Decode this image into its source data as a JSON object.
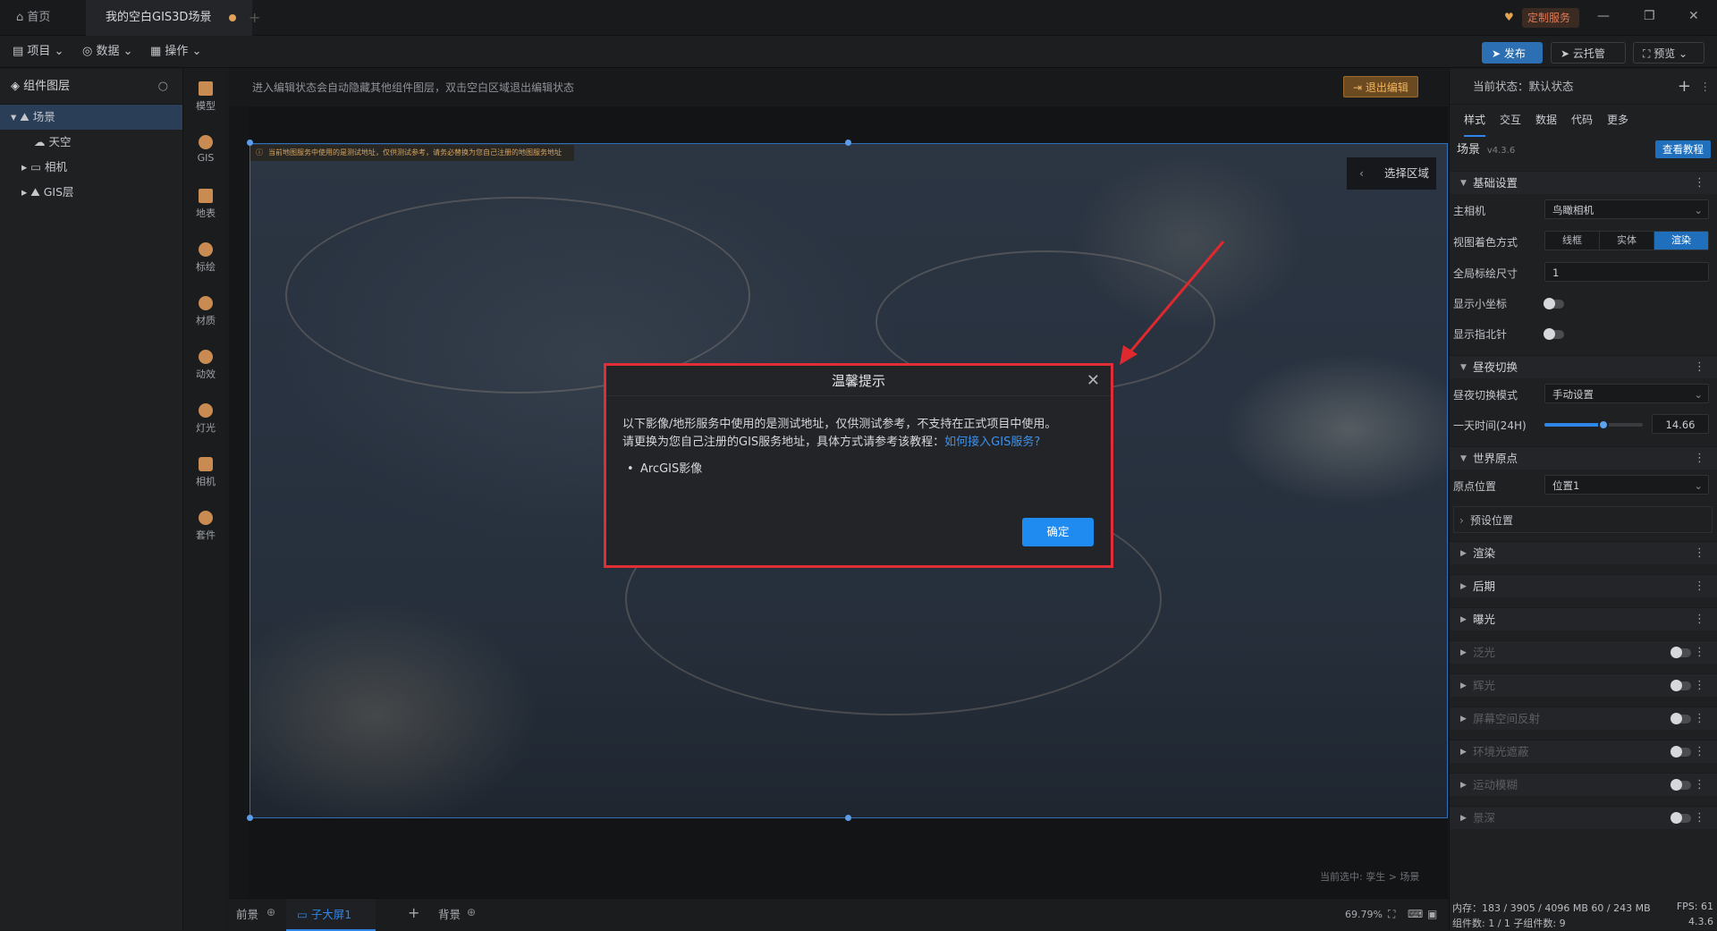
{
  "topbar": {
    "home": "首页",
    "project_tab": "我的空白GIS3D场景",
    "brand_badge": "定制服务"
  },
  "menubar": {
    "project": "项目",
    "data": "数据",
    "operate": "操作",
    "publish": "发布",
    "cloud": "云托管",
    "preview": "预览"
  },
  "left": {
    "title": "组件图层",
    "tree": [
      "场景",
      "天空",
      "相机",
      "GIS层"
    ]
  },
  "tools": [
    "模型",
    "GIS",
    "地表",
    "标绘",
    "材质",
    "动效",
    "灯光",
    "相机",
    "套件"
  ],
  "canvas": {
    "hint": "进入编辑状态会自动隐藏其他组件图层，双击空白区域退出编辑状态",
    "exit": "退出编辑",
    "warn": "当前地图服务中使用的是测试地址，仅供测试参考，请务必替换为您自己注册的地图服务地址",
    "select_region": "选择区域",
    "current_sel": "当前选中: 孪生 > 场景"
  },
  "modal": {
    "title": "温馨提示",
    "line1": "以下影像/地形服务中使用的是测试地址，仅供测试参考，不支持在正式项目中使用。",
    "line2_prefix": "请更换为您自己注册的GIS服务地址，具体方式请参考该教程：",
    "link": "如何接入GIS服务?",
    "item": "ArcGIS影像",
    "ok": "确定"
  },
  "bottom": {
    "front": "前景",
    "sub": "子大屏1",
    "bg": "背景",
    "zoom": "69.79%"
  },
  "right": {
    "state": "当前状态：默认状态",
    "tabs": [
      "样式",
      "交互",
      "数据",
      "代码",
      "更多"
    ],
    "scene_title": "场景",
    "version": "v4.3.6",
    "tutorial": "查看教程",
    "basic": "基础设置",
    "main_camera_label": "主相机",
    "main_camera": "鸟瞰相机",
    "view_mode_label": "视图着色方式",
    "view_modes": [
      "线框",
      "实体",
      "渲染"
    ],
    "global_size_label": "全局标绘尺寸",
    "global_size": "1",
    "show_coord": "显示小坐标",
    "show_north": "显示指北针",
    "daynight": "昼夜切换",
    "daynight_mode_label": "昼夜切换模式",
    "daynight_mode": "手动设置",
    "time_label": "一天时间(24H)",
    "time_value": "14.66",
    "time_fraction": 0.6,
    "origin": "世界原点",
    "origin_pos_label": "原点位置",
    "origin_pos": "位置1",
    "preset": "预设位置",
    "sections": [
      "渲染",
      "后期",
      "曝光"
    ],
    "dim_sections": [
      "泛光",
      "辉光",
      "屏幕空间反射",
      "环境光遮蔽",
      "运动模糊",
      "景深"
    ]
  },
  "status": {
    "mem": "内存：183 / 3905 / 4096 MB  60 / 243 MB",
    "fps": "FPS: 61",
    "comps": "组件数: 1 / 1   子组件数: 9",
    "ver": "4.3.6"
  }
}
